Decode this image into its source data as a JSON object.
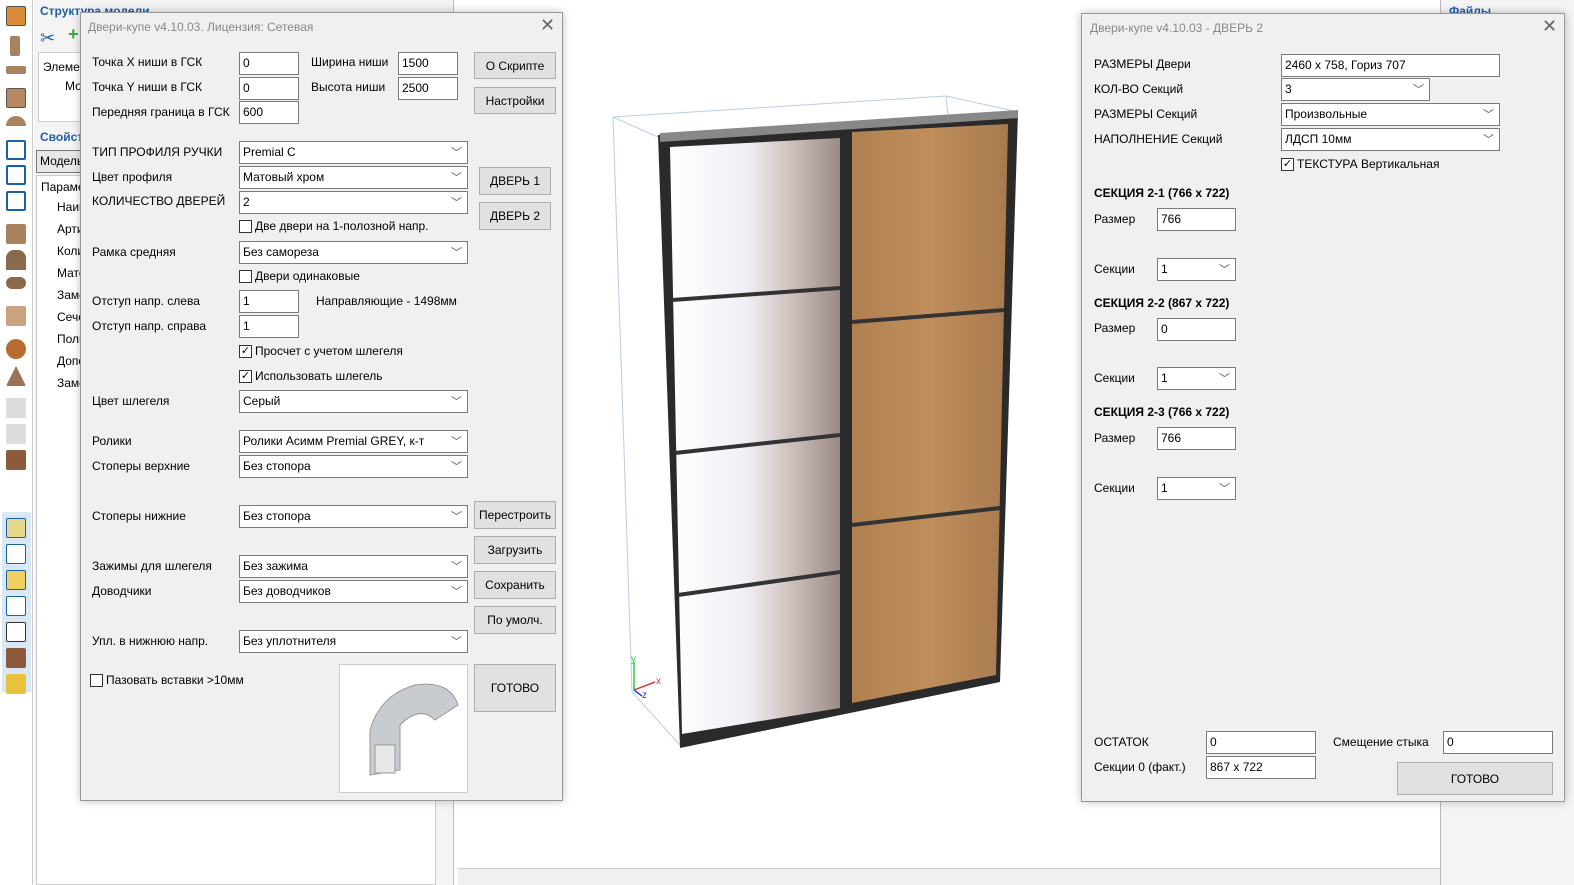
{
  "app": {
    "structure_title": "Структура модели",
    "elements_label": "Элемен",
    "model_node": "Мод",
    "properties_title": "Свойст",
    "model_tab": "Модель",
    "params_header": "Парамет",
    "param_rows": [
      "Наим",
      "Арти",
      "Коли",
      "Мате",
      "Заме",
      "Сече",
      "Поль",
      "Допо",
      "Заме"
    ],
    "files_title": "Файлы"
  },
  "dialog1": {
    "title": "Двери-купе v4.10.03.  Лицензия: Сетевая",
    "labels": {
      "x": "Точка X ниши в ГСК",
      "y": "Точка Y ниши в ГСК",
      "front": "Передняя граница в ГСК",
      "width": "Ширина ниши",
      "height": "Высота ниши",
      "profile_type": "ТИП ПРОФИЛЯ РУЧКИ",
      "profile_color": "Цвет профиля",
      "door_count": "КОЛИЧЕСТВО ДВЕРЕЙ",
      "middle_frame": "Рамка средняя",
      "indent_left": "Отступ напр. слева",
      "indent_right": "Отступ напр. справа",
      "brush_color": "Цвет шлегеля",
      "rollers": "Ролики",
      "stoppers_top": "Стоперы верхние",
      "stoppers_bottom": "Стоперы нижние",
      "clamps": "Зажимы для шлегеля",
      "closers": "Доводчики",
      "seal": "Упл. в нижнюю напр."
    },
    "values": {
      "x": "0",
      "y": "0",
      "front": "600",
      "width": "1500",
      "height": "2500",
      "profile_type": "Premial C",
      "profile_color": "Матовый хром",
      "door_count": "2",
      "middle_frame": "Без самореза",
      "indent_left": "1",
      "indent_right": "1",
      "brush_color": "Серый",
      "rollers": "Ролики Асимм Premial GREY, к-т",
      "stoppers_top": "Без стопора",
      "stoppers_bottom": "Без стопора",
      "clamps": "Без зажима",
      "closers": "Без доводчиков",
      "seal": "Без уплотнителя"
    },
    "rails_info": "Направляющие - 1498мм",
    "checkboxes": {
      "two_doors": {
        "label": "Две двери на 1-полозной напр.",
        "checked": false
      },
      "same_doors": {
        "label": "Двери одинаковые",
        "checked": false
      },
      "calc_brush": {
        "label": "Просчет с учетом шлегеля",
        "checked": true
      },
      "use_brush": {
        "label": "Использовать шлегель",
        "checked": true
      },
      "groove": {
        "label": "Пазовать вставки >10мм",
        "checked": false
      }
    },
    "buttons": {
      "about": "О Скрипте",
      "settings": "Настройки",
      "door1": "ДВЕРЬ 1",
      "door2": "ДВЕРЬ 2",
      "rebuild": "Перестроить",
      "load": "Загрузить",
      "save": "Сохранить",
      "default": "По умолч.",
      "done": "ГОТОВО"
    }
  },
  "dialog2": {
    "title": "Двери-купе v4.10.03  -  ДВЕРЬ 2",
    "labels": {
      "door_size": "РАЗМЕРЫ Двери",
      "section_count": "КОЛ-ВО Секций",
      "section_sizes": "РАЗМЕРЫ Секций",
      "section_fill": "НАПОЛНЕНИЕ Секций"
    },
    "values": {
      "door_size": "2460 x 758, Гориз 707",
      "section_count": "3",
      "section_sizes": "Произвольные",
      "section_fill": "ЛДСП 10мм"
    },
    "texture": {
      "label": "ТЕКСТУРА Вертикальная",
      "checked": true
    },
    "sections": [
      {
        "title": "СЕКЦИЯ 2-1   (766 x 722)",
        "size_label": "Размер",
        "size": "766",
        "sub_label": "Секции",
        "sub": "1"
      },
      {
        "title": "СЕКЦИЯ 2-2   (867 x 722)",
        "size_label": "Размер",
        "size": "0",
        "sub_label": "Секции",
        "sub": "1"
      },
      {
        "title": "СЕКЦИЯ 2-3   (766 x 722)",
        "size_label": "Размер",
        "size": "766",
        "sub_label": "Секции",
        "sub": "1"
      }
    ],
    "remainder_label": "ОСТАТОК",
    "remainder": "0",
    "fact_label": "Секции 0 (факт.)",
    "fact": "867 x 722",
    "offset_label": "Смещение стыка",
    "offset": "0",
    "done": "ГОТОВО"
  },
  "viewport": {
    "axis_x": "x",
    "axis_y": "y",
    "axis_z": "z"
  }
}
